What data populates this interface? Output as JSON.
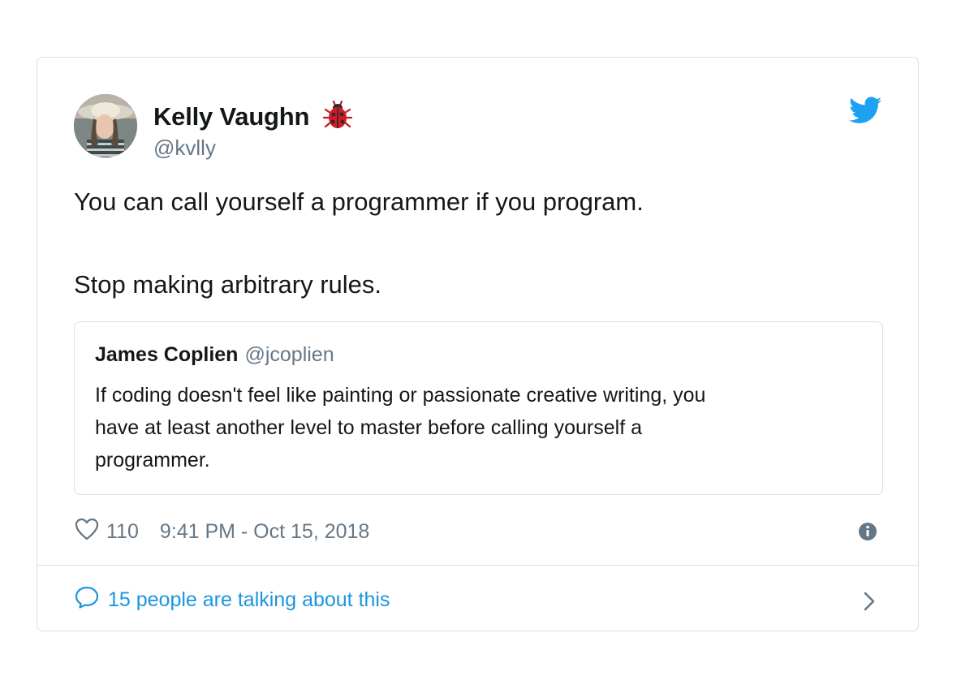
{
  "tweet": {
    "author": {
      "name": "Kelly Vaughn",
      "handle": "@kvlly",
      "badge_icon": "ladybug-icon"
    },
    "brand_icon": "twitter-bird-icon",
    "brand_color": "#1da1f2",
    "text_lines": [
      "You can call yourself a programmer if you program.",
      "Stop making arbitrary rules."
    ],
    "quoted": {
      "name": "James Coplien",
      "handle": "@jcoplien",
      "text_lines": [
        "If coding doesn't feel like painting or passionate creative writing, you",
        "have at least another level to master before calling yourself a",
        "programmer."
      ]
    },
    "likes": "110",
    "timestamp": "9:41 PM - Oct 15, 2018",
    "footer": {
      "label": "15 people are talking about this",
      "color": "#1b95e0"
    }
  }
}
